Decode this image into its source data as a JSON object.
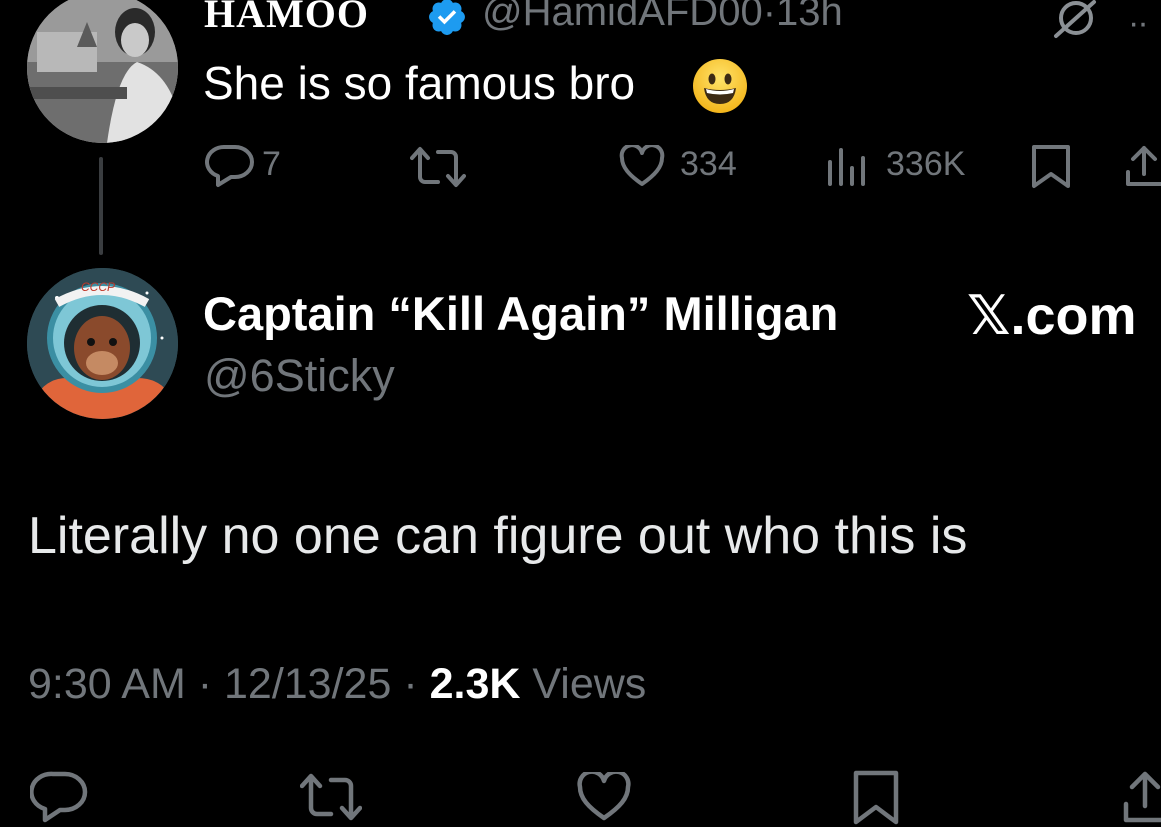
{
  "parent_tweet": {
    "display_name": "HAMOO",
    "handle": "@HamidAFD00",
    "separator": "·",
    "time_ago": "13h",
    "text": "She is so famous bro",
    "emoji": "grinning-face",
    "actions": {
      "replies": "7",
      "likes": "334",
      "views": "336K"
    },
    "verified_color": "#1d9bf0"
  },
  "main_tweet": {
    "display_name": "Captain “Kill Again” Milligan",
    "handle": "@6Sticky",
    "watermark": "𝕏.com",
    "text": "Literally no one can figure out who this is",
    "meta": {
      "time": "9:30 AM",
      "sep1": " · ",
      "date": "12/13/25",
      "sep2": " · ",
      "views_count": "2.3K",
      "views_label": " Views"
    },
    "avatar_badge": "CCCP"
  },
  "icons": [
    "reply-icon",
    "retweet-icon",
    "like-icon",
    "views-icon",
    "bookmark-icon",
    "share-icon",
    "grok-icon",
    "more-icon",
    "verified-icon"
  ],
  "colors": {
    "background": "#000000",
    "text_primary": "#e7e9ea",
    "text_secondary": "#71767b",
    "verified": "#1d9bf0"
  }
}
